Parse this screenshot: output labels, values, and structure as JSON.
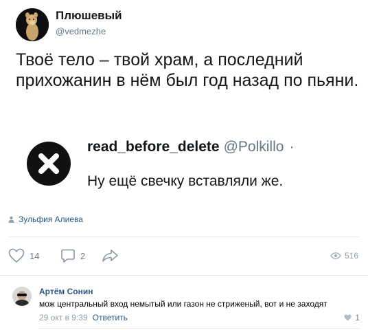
{
  "post": {
    "author_name": "Плюшевый",
    "author_handle": "@vedmezhe",
    "text": "Твоё тело – твой храм, а последний прихожанин в нём был год назад по пьяни."
  },
  "quoted": {
    "name": "read_before_delete",
    "handle": "@Polkillo",
    "dot": "·",
    "text": "Ну ещё свечку вставляли же."
  },
  "author_credit": "Зульфия Алиева",
  "actions": {
    "likes": "14",
    "comments": "2",
    "views": "516"
  },
  "comment": {
    "author": "Артём Сонин",
    "text": "мож центральный вход немытый или газон не стриженый, вот и не заходят",
    "date": "29 окт в 9:39",
    "reply_label": "Ответить",
    "likes": "1"
  },
  "colors": {
    "link": "#2a5885",
    "muted": "#939ca8",
    "icon": "#6f7a87"
  }
}
